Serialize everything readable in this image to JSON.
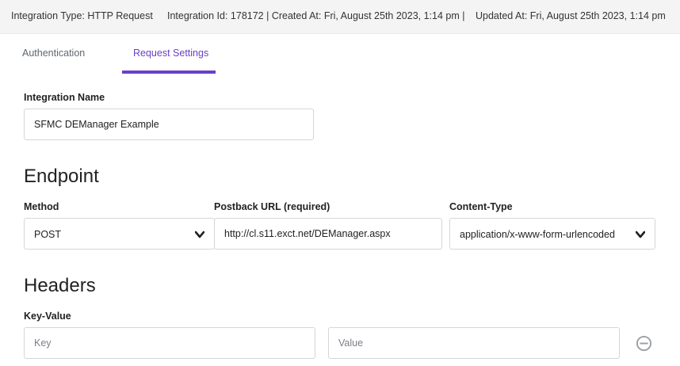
{
  "header": {
    "integration_type": "Integration Type: HTTP Request",
    "integration_info": "Integration Id: 178172 | Created At: Fri, August 25th 2023, 1:14 pm |",
    "updated_at": "Updated At: Fri, August 25th 2023, 1:14 pm"
  },
  "tabs": [
    {
      "label": "Authentication",
      "active": false
    },
    {
      "label": "Request Settings",
      "active": true
    }
  ],
  "integration_name": {
    "label": "Integration Name",
    "value": "SFMC DEManager Example"
  },
  "endpoint": {
    "heading": "Endpoint",
    "method": {
      "label": "Method",
      "value": "POST"
    },
    "postback_url": {
      "label": "Postback URL (required)",
      "value": "http://cl.s11.exct.net/DEManager.aspx"
    },
    "content_type": {
      "label": "Content-Type",
      "value": "application/x-www-form-urlencoded"
    }
  },
  "headers": {
    "heading": "Headers",
    "key_value_label": "Key-Value",
    "key_placeholder": "Key",
    "value_placeholder": "Value"
  },
  "colors": {
    "accent": "#6a3fc7",
    "topbar_bg": "#f4f4f5",
    "border": "#d4d6da"
  },
  "icons": {
    "dropdown": "chevron-down-icon",
    "remove": "minus-circle-icon"
  }
}
